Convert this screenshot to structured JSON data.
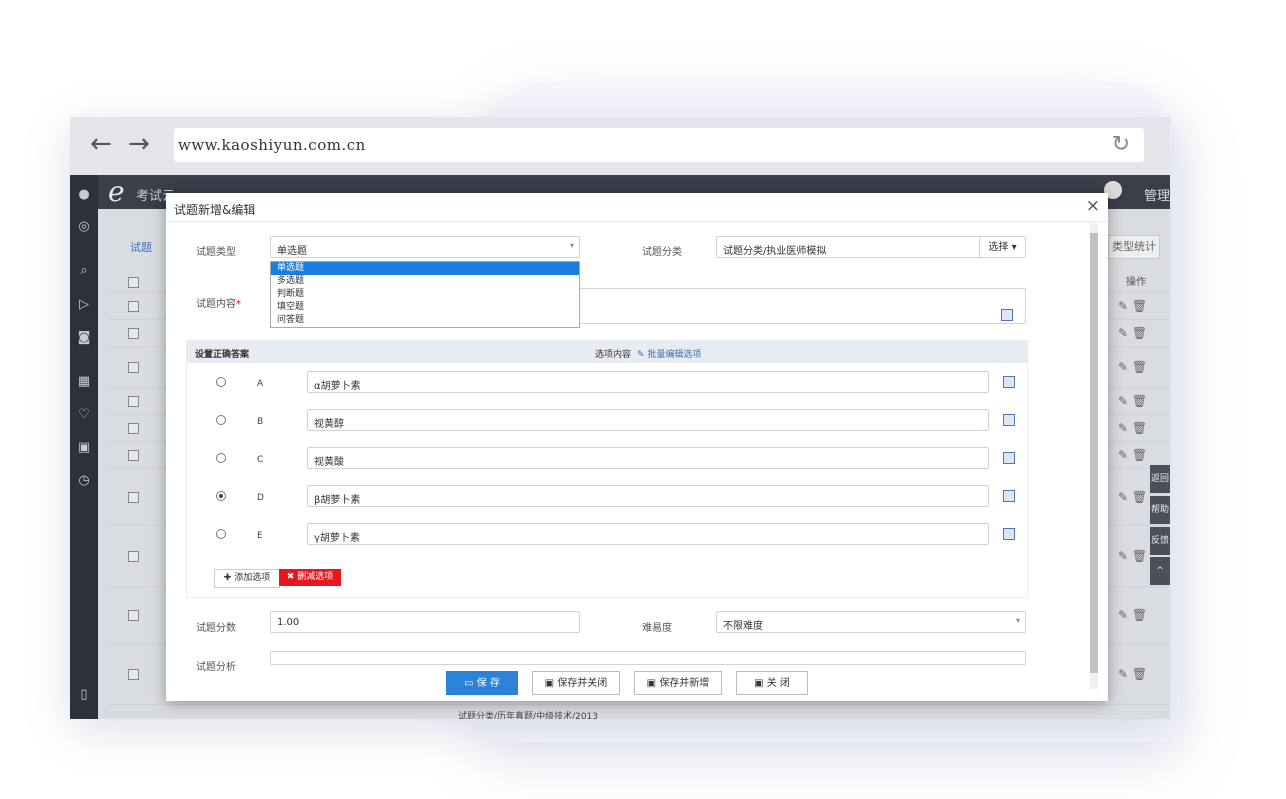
{
  "browser": {
    "url": "www.kaoshiyun.com.cn",
    "back_icon": "arrow-left",
    "forward_icon": "arrow-right",
    "refresh_icon": "refresh"
  },
  "app": {
    "logo_text": "考试云",
    "admin_label": "管理"
  },
  "background_table": {
    "tab_label": "试题",
    "right_button": "类型统计",
    "operations_header": "操作",
    "bottom_path": "试题分类/历年真题/中级技术/2013",
    "side_tabs": [
      "返回",
      "帮助",
      "反馈"
    ]
  },
  "modal": {
    "title": "试题新增&编辑",
    "type_label": "试题类型",
    "type_value": "单选题",
    "type_options": [
      "单选题",
      "多选题",
      "判断题",
      "填空题",
      "问答题"
    ],
    "category_label": "试题分类",
    "category_value": "试题分类/执业医师模拟",
    "category_button": "选择 ▾",
    "content_label": "试题内容",
    "answer_header": "设置正确答案",
    "options_header": "选项内容",
    "batch_edit": "✎ 批量编辑选项",
    "options": [
      {
        "letter": "A",
        "text": "α胡萝卜素",
        "checked": false
      },
      {
        "letter": "B",
        "text": "视黄醇",
        "checked": false
      },
      {
        "letter": "C",
        "text": "视黄酸",
        "checked": false
      },
      {
        "letter": "D",
        "text": "β胡萝卜素",
        "checked": true
      },
      {
        "letter": "E",
        "text": "γ胡萝卜素",
        "checked": false
      }
    ],
    "add_option": "✚ 添加选项",
    "delete_option": "✖ 删减选项",
    "score_label": "试题分数",
    "score_value": "1.00",
    "difficulty_label": "难易度",
    "difficulty_value": "不限难度",
    "analysis_label": "试题分析",
    "footer": {
      "save": "保 存",
      "save_close": "保存并关闭",
      "save_new": "保存并新增",
      "close": "关 闭"
    }
  }
}
